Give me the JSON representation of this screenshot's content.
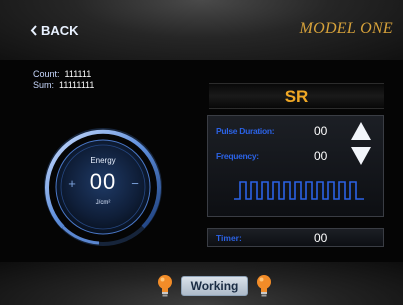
{
  "header": {
    "back_label": "BACK",
    "title": "MODEL ONE"
  },
  "counts": {
    "count_label": "Count:",
    "count_value": "111111",
    "sum_label": "Sum:",
    "sum_value": "11111111"
  },
  "energy": {
    "label": "Energy",
    "value": "00",
    "unit": "J/cm²",
    "plus": "+",
    "minus": "−"
  },
  "mode": "SR",
  "params": {
    "pulse_duration_label": "Pulse Duration:",
    "pulse_duration_value": "00",
    "frequency_label": "Frequency:",
    "frequency_value": "00"
  },
  "timer": {
    "label": "Timer:",
    "value": "00"
  },
  "footer": {
    "status_button": "Working"
  },
  "colors": {
    "accent_blue": "#2b62e5",
    "title_gold": "#d7a23a",
    "mode_orange": "#f0a825",
    "bulb_orange": "#f28c28"
  }
}
